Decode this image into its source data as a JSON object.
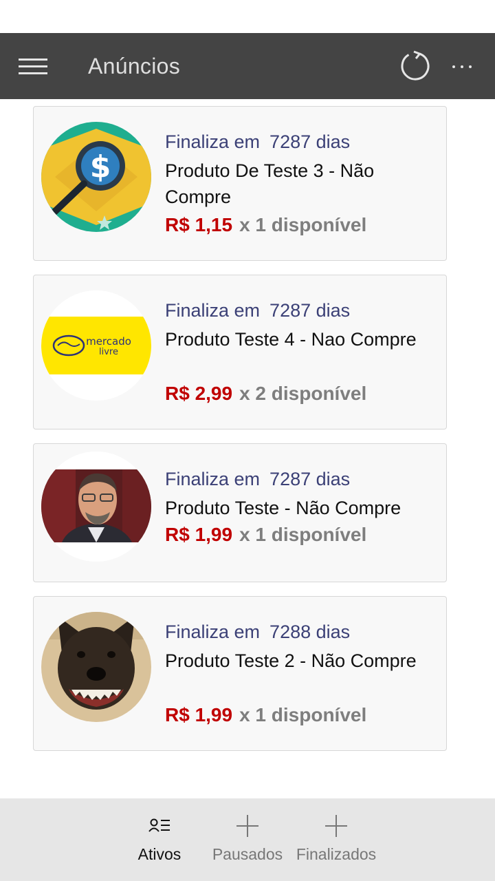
{
  "appbar": {
    "title": "Anúncios",
    "menu_icon": "hamburger-menu-icon",
    "refresh_icon": "refresh-icon",
    "more_icon": "more-options-icon",
    "background": "#444444"
  },
  "listings": [
    {
      "expires_label": "Finaliza em",
      "expires_days": "7287 dias",
      "title": "Produto De Teste 3 - Não Compre",
      "price": "R$ 1,15",
      "availability": "x 1 disponível",
      "image": "brazil-dollar-magnifier-logo"
    },
    {
      "expires_label": "Finaliza em",
      "expires_days": "7287 dias",
      "title": "Produto Teste 4 - Nao Compre",
      "price": "R$ 2,99",
      "availability": "x 2 disponível",
      "image": "mercado-livre-logo",
      "logo_text_1": "mercado",
      "logo_text_2": "livre"
    },
    {
      "expires_label": "Finaliza em",
      "expires_days": "7287 dias",
      "title": "Produto Teste - Não Compre",
      "price": "R$ 1,99",
      "availability": "x 1 disponível",
      "image": "man-portrait-photo"
    },
    {
      "expires_label": "Finaliza em",
      "expires_days": "7288 dias",
      "title": "Produto Teste 2 - Não Compre",
      "price": "R$ 1,99",
      "availability": "x 1 disponível",
      "image": "grinning-dog-photo"
    }
  ],
  "tabs": [
    {
      "label": "Ativos",
      "icon": "person-list-icon",
      "active": true
    },
    {
      "label": "Pausados",
      "icon": "plus-icon",
      "active": false
    },
    {
      "label": "Finalizados",
      "icon": "plus-icon",
      "active": false
    }
  ],
  "colors": {
    "expires_text": "#3b4076",
    "price_text": "#c00000",
    "availability_text": "#7e7e7e",
    "card_background": "#f8f8f8",
    "bottom_bar": "#e6e6e6"
  }
}
